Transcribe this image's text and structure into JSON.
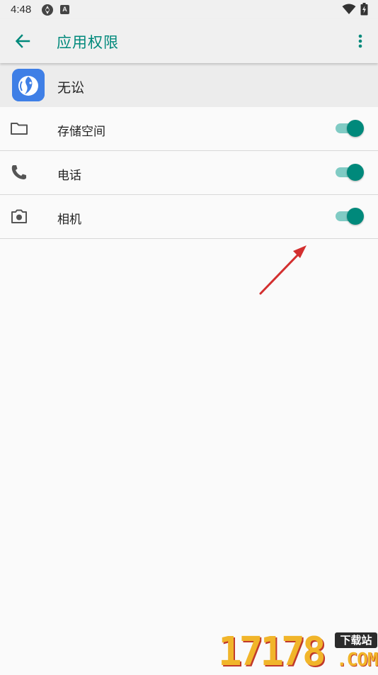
{
  "status_bar": {
    "time": "4:48",
    "icons": [
      "sync-icon",
      "a-badge-icon",
      "wifi-icon",
      "battery-icon"
    ],
    "badge_letter": "A"
  },
  "app_bar": {
    "title": "应用权限",
    "back_icon": "arrow-left-icon",
    "overflow_icon": "more-vertical-icon",
    "accent_color": "#00897b"
  },
  "app_header": {
    "name": "无讼",
    "icon": "app-logo-icon"
  },
  "permissions": [
    {
      "label": "存储空间",
      "icon": "folder-icon",
      "enabled": true
    },
    {
      "label": "电话",
      "icon": "phone-icon",
      "enabled": true
    },
    {
      "label": "相机",
      "icon": "camera-icon",
      "enabled": true
    }
  ],
  "watermark": {
    "digits": "17178",
    "badge": "下载站",
    "domain": ".COM"
  }
}
